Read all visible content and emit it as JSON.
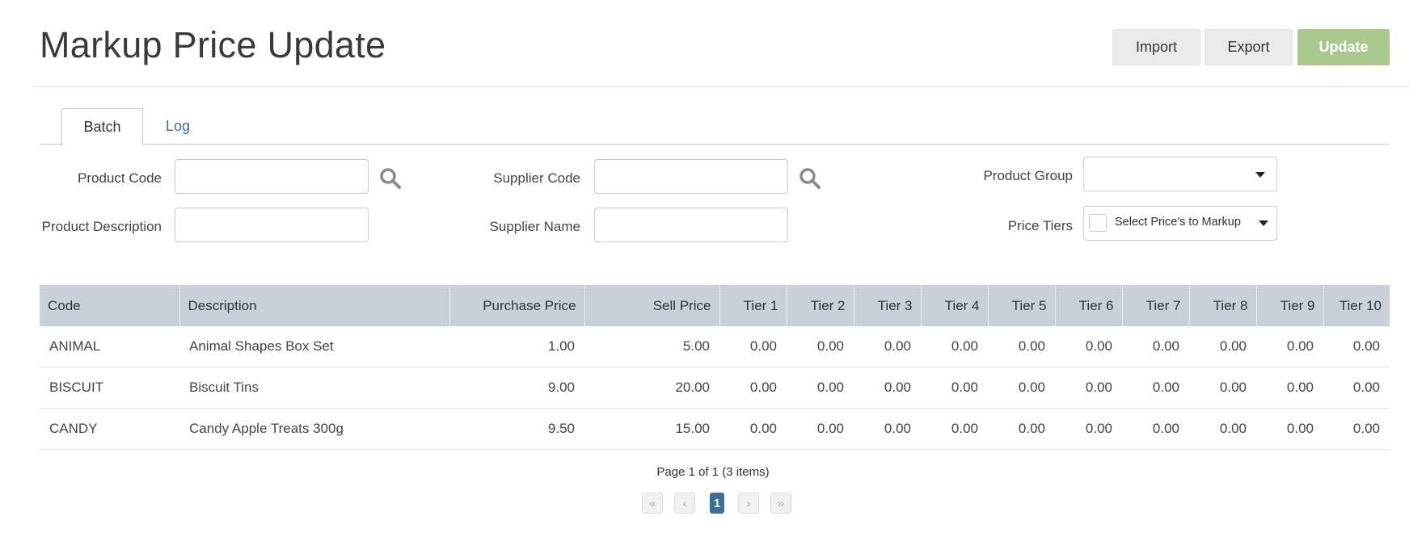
{
  "page": {
    "title": "Markup Price Update"
  },
  "toolbar": {
    "import_label": "Import",
    "export_label": "Export",
    "update_label": "Update"
  },
  "tabs": [
    {
      "label": "Batch"
    },
    {
      "label": "Log"
    }
  ],
  "filters": {
    "product_code": {
      "label": "Product Code",
      "value": ""
    },
    "product_description": {
      "label": "Product Description",
      "value": ""
    },
    "supplier_code": {
      "label": "Supplier Code",
      "value": ""
    },
    "supplier_name": {
      "label": "Supplier Name",
      "value": ""
    },
    "product_group": {
      "label": "Product Group",
      "value": ""
    },
    "price_tiers": {
      "label": "Price Tiers",
      "placeholder": "Select Price's to Markup"
    }
  },
  "table": {
    "columns": [
      "Code",
      "Description",
      "Purchase Price",
      "Sell Price",
      "Tier 1",
      "Tier 2",
      "Tier 3",
      "Tier 4",
      "Tier 5",
      "Tier 6",
      "Tier 7",
      "Tier 8",
      "Tier 9",
      "Tier 10"
    ],
    "rows": [
      {
        "code": "ANIMAL",
        "description": "Animal Shapes Box Set",
        "purchase": "1.00",
        "sell": "5.00",
        "tiers": [
          "0.00",
          "0.00",
          "0.00",
          "0.00",
          "0.00",
          "0.00",
          "0.00",
          "0.00",
          "0.00",
          "0.00"
        ]
      },
      {
        "code": "BISCUIT",
        "description": "Biscuit Tins",
        "purchase": "9.00",
        "sell": "20.00",
        "tiers": [
          "0.00",
          "0.00",
          "0.00",
          "0.00",
          "0.00",
          "0.00",
          "0.00",
          "0.00",
          "0.00",
          "0.00"
        ]
      },
      {
        "code": "CANDY",
        "description": "Candy Apple Treats 300g",
        "purchase": "9.50",
        "sell": "15.00",
        "tiers": [
          "0.00",
          "0.00",
          "0.00",
          "0.00",
          "0.00",
          "0.00",
          "0.00",
          "0.00",
          "0.00",
          "0.00"
        ]
      }
    ]
  },
  "pager": {
    "info": "Page 1 of 1 (3 items)",
    "first": "«",
    "prev": "‹",
    "current": "1",
    "next": "›",
    "last": "»"
  },
  "colors": {
    "accent": "#3a6e9c",
    "update_button": "#a8c98b",
    "table_header": "#c9d0d9"
  },
  "icons": {
    "search": "search-icon",
    "dropdown": "chevron-down-icon"
  }
}
